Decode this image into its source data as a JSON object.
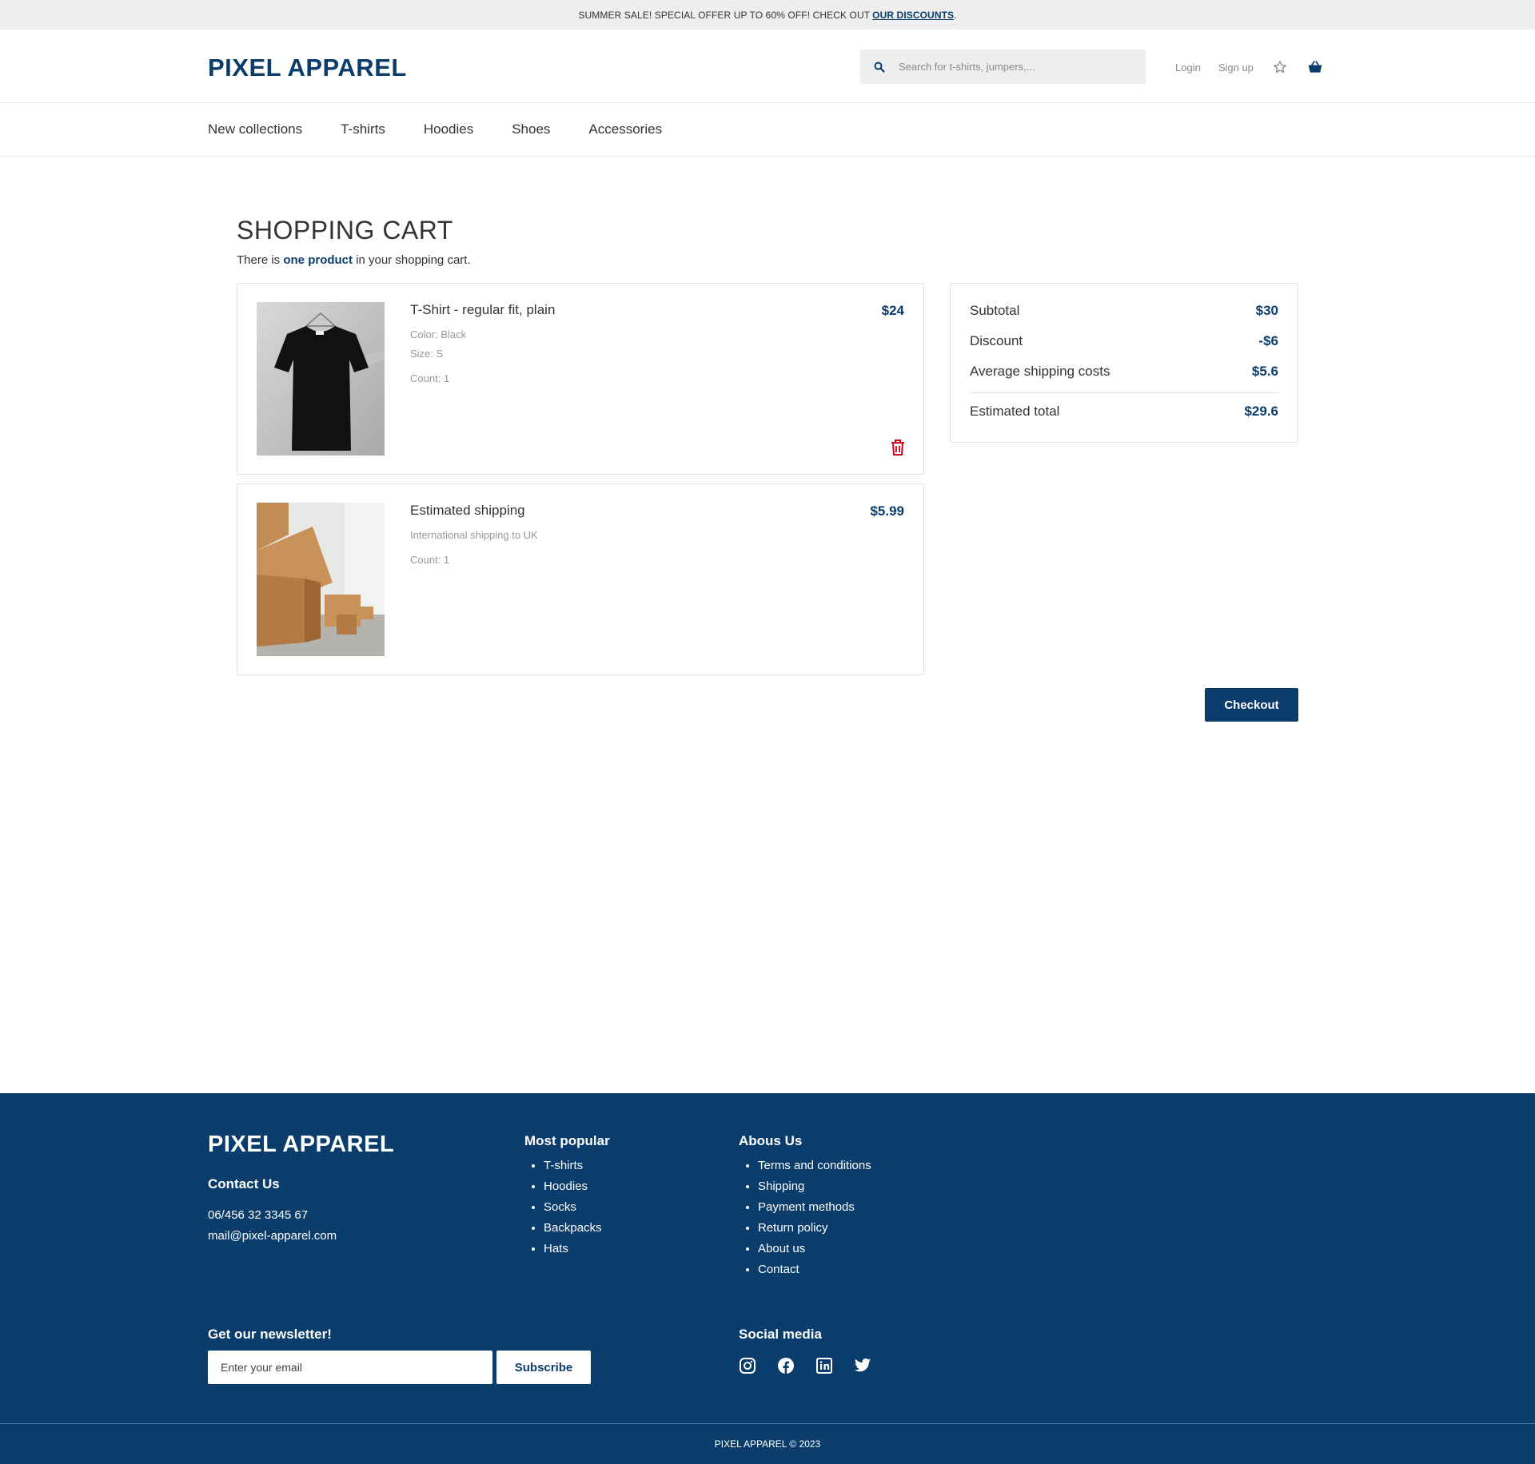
{
  "banner": {
    "text": "SUMMER SALE! SPECIAL OFFER UP TO 60% OFF! CHECK OUT",
    "link": "OUR DISCOUNTS",
    "end": "."
  },
  "header": {
    "logo": "PIXEL APPAREL",
    "search_placeholder": "Search for t-shirts, jumpers,...",
    "login": "Login",
    "signup": "Sign up"
  },
  "nav": {
    "items": [
      "New collections",
      "T-shirts",
      "Hoodies",
      "Shoes",
      "Accessories"
    ]
  },
  "cart": {
    "title": "SHOPPING CART",
    "sub_before": "There is ",
    "sub_highlight": "one product",
    "sub_after": " in your shopping cart.",
    "items": [
      {
        "name": "T-Shirt - regular fit, plain",
        "color": "Color: Black",
        "size": "Size: S",
        "count": "Count: 1",
        "price": "$24"
      },
      {
        "name": "Estimated shipping",
        "desc": "International shipping to UK",
        "count": "Count: 1",
        "price": "$5.99"
      }
    ]
  },
  "summary": {
    "subtotal_label": "Subtotal",
    "subtotal": "$30",
    "discount_label": "Discount",
    "discount": "-$6",
    "shipping_label": "Average shipping costs",
    "shipping": "$5.6",
    "total_label": "Estimated total",
    "total": "$29.6"
  },
  "checkout_label": "Checkout",
  "footer": {
    "logo": "PIXEL APPAREL",
    "contact_title": "Contact Us",
    "phone": "06/456 32 3345 67",
    "email": "mail@pixel-apparel.com",
    "popular_title": "Most popular",
    "popular": [
      "T-shirts",
      "Hoodies",
      "Socks",
      "Backpacks",
      "Hats"
    ],
    "about_title": "Abous Us",
    "about": [
      "Terms and conditions",
      "Shipping",
      "Payment methods",
      "Return policy",
      "About us",
      "Contact"
    ],
    "newsletter_title": "Get our newsletter!",
    "newsletter_placeholder": "Enter your email",
    "subscribe": "Subscribe",
    "social_title": "Social media",
    "copyright": "PIXEL APPAREL © 2023"
  },
  "colors": {
    "brand": "#0a3d6b",
    "danger": "#d0021b"
  }
}
